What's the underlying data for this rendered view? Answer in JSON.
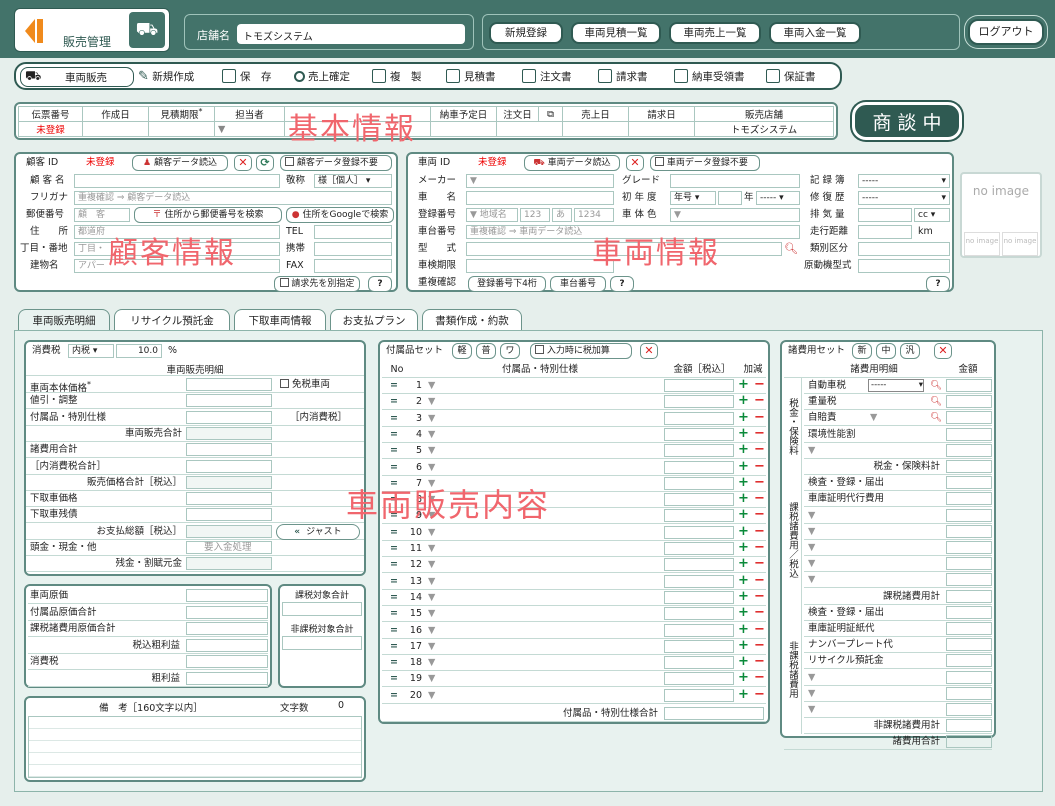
{
  "app": {
    "title": "販売管理",
    "shop_label": "店舗名",
    "shop_name": "トモズシステム"
  },
  "nav": {
    "items": [
      "新規登録",
      "車両見積一覧",
      "車両売上一覧",
      "車両入金一覧"
    ],
    "logout": "ログアウト"
  },
  "toolbar": {
    "mode": "車両販売",
    "items": [
      "新規作成",
      "保　存",
      "売上確定",
      "複　製",
      "見積書",
      "注文書",
      "請求書",
      "納車受領書",
      "保証書"
    ]
  },
  "basic": {
    "headers": [
      "伝票番号",
      "作成日",
      "見積期限",
      "担当者",
      "",
      "",
      "納車予定日",
      "注文日",
      "",
      "売上日",
      "請求日",
      "販売店舗"
    ],
    "required_mark": "*",
    "unregistered": "未登録",
    "shop": "トモズシステム",
    "watermark": "基本情報"
  },
  "status": "商 談 中",
  "customer": {
    "id_label": "顧客 ID",
    "id_value": "未登録",
    "read_btn": "顧客データ読込",
    "no_register": "顧客データ登録不要",
    "name": "顧 客 名",
    "title_label": "敬称",
    "title_value": "様［個人］",
    "furigana": "フリガナ",
    "dup_check": "重複確認 ⇒ 顧客データ読込",
    "zip": "郵便番号",
    "zip_ph": "顧　客",
    "addr_search": "住所から郵便番号を検索",
    "google": "住所をGoogleで検索",
    "address": "住　　所",
    "address_ph": "都道府",
    "block": "丁目・番地",
    "block_ph": "丁目・",
    "building": "建物名",
    "building_ph": "アパー",
    "tel": "TEL",
    "mobile": "携帯",
    "fax": "FAX",
    "billing": "請求先を別指定",
    "help": "?",
    "watermark": "顧客情報"
  },
  "vehicle": {
    "id_label": "車両 ID",
    "id_value": "未登録",
    "read_btn": "車両データ読込",
    "no_register": "車両データ登録不要",
    "maker": "メーカー",
    "grade": "グレード",
    "reg_book": "記 録 簿",
    "car_name": "車　　名",
    "first_year": "初 年 度",
    "era": "年号",
    "year_unit": "年",
    "repair": "修 復 歴",
    "reg_no": "登録番号",
    "reg_ph": [
      "地域名",
      "123",
      "あ",
      "1234"
    ],
    "body_color": "車 体 色",
    "displacement": "排 気 量",
    "cc": "cc",
    "chassis": "車台番号",
    "chassis_ph": "重複確認 ⇒ 車両データ読込",
    "mileage": "走行距離",
    "km": "km",
    "model": "型　　式",
    "class": "類別区分",
    "inspection": "車検期限",
    "engine": "原動機型式",
    "dup": "重複確認",
    "dup_reg": "登録番号下4桁",
    "dup_chassis": "車台番号",
    "select_empty": "-----",
    "help": "?",
    "watermark": "車両情報"
  },
  "noimage": {
    "main": "no image",
    "sub1": "no image",
    "sub2": "no image"
  },
  "tabs": [
    "車両販売明細",
    "リサイクル預託金",
    "下取車両情報",
    "お支払プラン",
    "書類作成・約款"
  ],
  "sales": {
    "tax_label": "消費税",
    "tax_type": "内税",
    "tax_rate": "10.0",
    "pct": "%",
    "header": "車両販売明細",
    "rows": [
      "車両本体価格",
      "値引・調整",
      "付属品・特別仕様",
      "車両販売合計",
      "諸費用合計",
      "［内消費税合計］",
      "販売価格合計［税込］",
      "下取車価格",
      "下取車残債",
      "お支払総額［税込］",
      "頭金・現金・他",
      "残金・割賦元金"
    ],
    "tax_free": "免税車両",
    "inner_tax": "［内消費税］",
    "just": "ジャスト",
    "deposit": "要入金処理",
    "watermark": "車両販売内容"
  },
  "cost": {
    "rows": [
      "車両原価",
      "付属品原価合計",
      "課税諸費用原価合計",
      "税込粗利益",
      "消費税",
      "粗利益"
    ],
    "taxable": "課税対象合計",
    "nontaxable": "非課税対象合計"
  },
  "memo": {
    "label": "備　考［160文字以内］",
    "count_label": "文字数",
    "count": "0"
  },
  "accessory": {
    "set_label": "付属品セット",
    "set_btns": [
      "軽",
      "普",
      "ワ"
    ],
    "tax_add": "入力時に税加算",
    "cols": [
      "No",
      "付属品・特別仕様",
      "金額［税込］",
      "加減"
    ],
    "total": "付属品・特別仕様合計",
    "rows": 20
  },
  "fees": {
    "set_label": "諸費用セット",
    "set_btns": [
      "新",
      "中",
      "汎"
    ],
    "cols": [
      "諸費用明細",
      "金額"
    ],
    "group1": "税金・保険料",
    "g1_rows": [
      "自動車税",
      "重量税",
      "自賠責",
      "環境性能割"
    ],
    "g1_select": "-----",
    "g1_total": "税金・保険料計",
    "group2": "課税諸費用／税込",
    "g2_rows": [
      "検査・登録・届出",
      "車庫証明代行費用"
    ],
    "g2_total": "課税諸費用計",
    "group3": "非課税諸費用",
    "g3_rows": [
      "検査・登録・届出",
      "車庫証明証紙代",
      "ナンバープレート代",
      "リサイクル預託金"
    ],
    "g3_total": "非課税諸費用計",
    "grand": "諸費用合計"
  },
  "colors": {
    "primary": "#43736a",
    "dark": "#2f5a52",
    "accent_red": "#e00000",
    "watermark": "#f0666d"
  }
}
